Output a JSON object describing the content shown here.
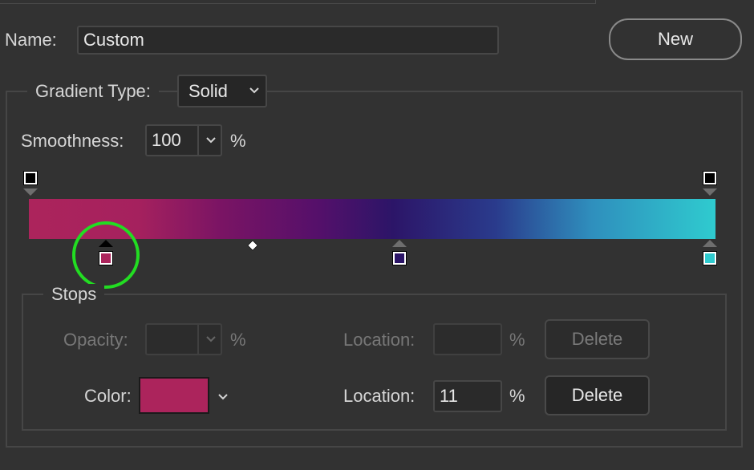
{
  "name_row": {
    "label": "Name:",
    "value": "Custom",
    "new_button": "New"
  },
  "gradient": {
    "type_label": "Gradient Type:",
    "type_value": "Solid",
    "smoothness_label": "Smoothness:",
    "smoothness_value": "100",
    "smoothness_unit": "%",
    "colors": {
      "magenta": "#ac245c",
      "purple": "#2c1568",
      "cyan": "#2fcbcf",
      "highlight": "#22dd22"
    },
    "selected_stop_location_percent": 11
  },
  "stops": {
    "title": "Stops",
    "opacity_label": "Opacity:",
    "opacity_value": "",
    "opacity_unit": "%",
    "opacity_location_label": "Location:",
    "opacity_location_value": "",
    "opacity_location_unit": "%",
    "opacity_delete": "Delete",
    "color_label": "Color:",
    "color_swatch": "#ac245c",
    "color_location_label": "Location:",
    "color_location_value": "11",
    "color_location_unit": "%",
    "color_delete": "Delete"
  }
}
